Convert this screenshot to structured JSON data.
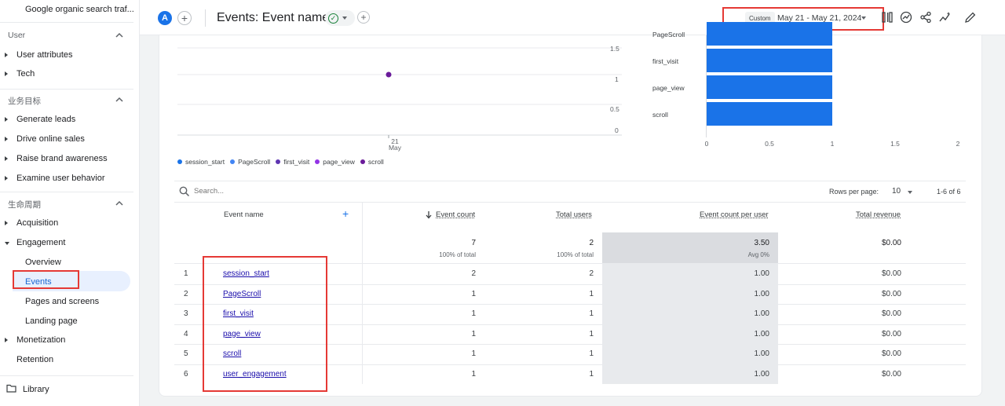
{
  "sidebar": {
    "top_item": "Google organic search traf...",
    "sections": [
      {
        "title": "User",
        "items": [
          {
            "label": "User attributes"
          },
          {
            "label": "Tech"
          }
        ]
      },
      {
        "title": "业务目标",
        "items": [
          {
            "label": "Generate leads"
          },
          {
            "label": "Drive online sales"
          },
          {
            "label": "Raise brand awareness"
          },
          {
            "label": "Examine user behavior"
          }
        ]
      },
      {
        "title": "生命周期",
        "items": [
          {
            "label": "Acquisition"
          },
          {
            "label": "Engagement"
          }
        ]
      }
    ],
    "engagement_sub": [
      "Overview",
      "Events",
      "Pages and screens",
      "Landing page"
    ],
    "after": [
      "Monetization",
      "Retention"
    ],
    "library": "Library"
  },
  "header": {
    "avatar": "A",
    "title": "Events: Event name",
    "date_custom": "Custom",
    "date_range": "May 21 - May 21, 2024",
    "icons": [
      "compare-icon",
      "insights-icon",
      "share-icon",
      "trend-icon",
      "edit-icon"
    ]
  },
  "line_chart": {
    "yticks": [
      "1.5",
      "1",
      "0.5",
      "0"
    ],
    "xtick_day": "21",
    "xtick_month": "May",
    "legend": [
      {
        "name": "session_start",
        "color": "#1a73e8"
      },
      {
        "name": "PageScroll",
        "color": "#4285f4"
      },
      {
        "name": "first_visit",
        "color": "#5e35b1"
      },
      {
        "name": "page_view",
        "color": "#9334e6"
      },
      {
        "name": "scroll",
        "color": "#6a1b9a"
      }
    ]
  },
  "chart_data": {
    "type": "bar",
    "orientation": "horizontal",
    "categories": [
      "PageScroll",
      "first_visit",
      "page_view",
      "scroll"
    ],
    "values": [
      1,
      1,
      1,
      1
    ],
    "xticks": [
      "0",
      "0.5",
      "1",
      "1.5",
      "2"
    ],
    "xlim": [
      0,
      2
    ],
    "color": "#1a73e8"
  },
  "table": {
    "search_placeholder": "Search...",
    "rows_per_page_label": "Rows per page:",
    "rows_per_page": "10",
    "pager": "1-6 of 6",
    "headers": {
      "event_name": "Event name",
      "event_count": "Event count",
      "total_users": "Total users",
      "per_user": "Event count per user",
      "revenue": "Total revenue"
    },
    "totals": {
      "event_count": "7",
      "event_count_sub": "100% of total",
      "total_users": "2",
      "total_users_sub": "100% of total",
      "per_user": "3.50",
      "per_user_sub": "Avg 0%",
      "revenue": "$0.00"
    },
    "rows": [
      {
        "n": "1",
        "name": "session_start",
        "count": "2",
        "users": "2",
        "per_user": "1.00",
        "revenue": "$0.00"
      },
      {
        "n": "2",
        "name": "PageScroll",
        "count": "1",
        "users": "1",
        "per_user": "1.00",
        "revenue": "$0.00"
      },
      {
        "n": "3",
        "name": "first_visit",
        "count": "1",
        "users": "1",
        "per_user": "1.00",
        "revenue": "$0.00"
      },
      {
        "n": "4",
        "name": "page_view",
        "count": "1",
        "users": "1",
        "per_user": "1.00",
        "revenue": "$0.00"
      },
      {
        "n": "5",
        "name": "scroll",
        "count": "1",
        "users": "1",
        "per_user": "1.00",
        "revenue": "$0.00"
      },
      {
        "n": "6",
        "name": "user_engagement",
        "count": "1",
        "users": "1",
        "per_user": "1.00",
        "revenue": "$0.00"
      }
    ]
  }
}
